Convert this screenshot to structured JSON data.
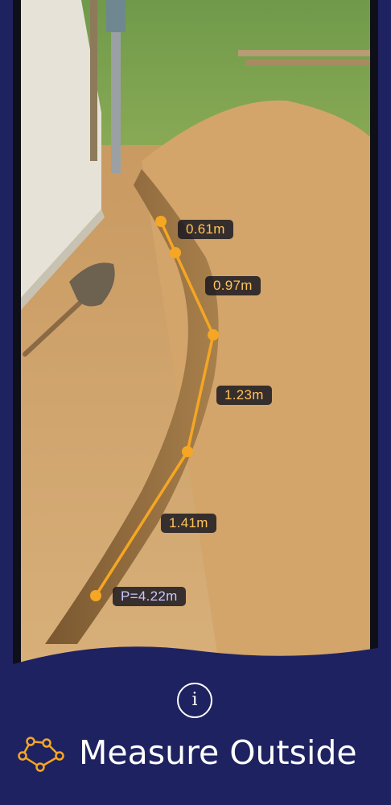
{
  "measurement": {
    "segments": [
      "0.61m",
      "0.97m",
      "1.23m",
      "1.41m"
    ],
    "total": "P=4.22m"
  },
  "info_button": {
    "label": "i",
    "icon": "info-icon"
  },
  "mode": {
    "title": "Measure Outside",
    "icon": "polygon-measure-icon"
  },
  "colors": {
    "accent": "#f5a623",
    "panel": "#1f2260",
    "label_text": "#ffc35a",
    "total_text": "#c8c8ff"
  }
}
